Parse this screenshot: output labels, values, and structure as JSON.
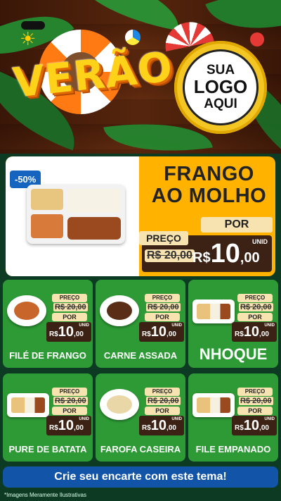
{
  "header": {
    "title": "VERÃO",
    "logo_placeholder": [
      "SUA",
      "LOGO",
      "AQUI"
    ]
  },
  "featured": {
    "discount": "-50%",
    "name_line1": "FRANGO",
    "name_line2": "AO MOLHO",
    "price_label": "PREÇO",
    "old_price": "R$ 20,00",
    "por_label": "POR",
    "currency": "R$",
    "new_price_int": "10",
    "new_price_cents": ",00",
    "unit": "UNID"
  },
  "products": [
    {
      "name": "FILÉ DE FRANGO",
      "price_label": "PREÇO",
      "old_price": "R$ 20,00",
      "por_label": "POR",
      "currency": "R$",
      "new_price_int": "10",
      "new_price_cents": ",00",
      "unit": "UNID"
    },
    {
      "name": "CARNE ASSADA",
      "price_label": "PREÇO",
      "old_price": "R$ 20,00",
      "por_label": "POR",
      "currency": "R$",
      "new_price_int": "10",
      "new_price_cents": ",00",
      "unit": "UNID"
    },
    {
      "name": "NHOQUE",
      "price_label": "PREÇO",
      "old_price": "R$ 20,00",
      "por_label": "POR",
      "currency": "R$",
      "new_price_int": "10",
      "new_price_cents": ",00",
      "unit": "UNID"
    },
    {
      "name": "PURE DE BATATA",
      "price_label": "PREÇO",
      "old_price": "R$ 20,00",
      "por_label": "POR",
      "currency": "R$",
      "new_price_int": "10",
      "new_price_cents": ",00",
      "unit": "UNID"
    },
    {
      "name": "FAROFA CASEIRA",
      "price_label": "PREÇO",
      "old_price": "R$ 20,00",
      "por_label": "POR",
      "currency": "R$",
      "new_price_int": "10",
      "new_price_cents": ",00",
      "unit": "UNID"
    },
    {
      "name": "FILE EMPANADO",
      "price_label": "PREÇO",
      "old_price": "R$ 20,00",
      "por_label": "POR",
      "currency": "R$",
      "new_price_int": "10",
      "new_price_cents": ",00",
      "unit": "UNID"
    }
  ],
  "cta": {
    "label": "Crie seu encarte com este tema!"
  },
  "footer": {
    "note": "*Imagens Meramente Ilustrativas"
  },
  "colors": {
    "accent_orange": "#ffb300",
    "card_green": "#2d9a35",
    "price_brown": "#3b2214",
    "cta_blue": "#1254a8",
    "discount_blue": "#1565c0"
  }
}
